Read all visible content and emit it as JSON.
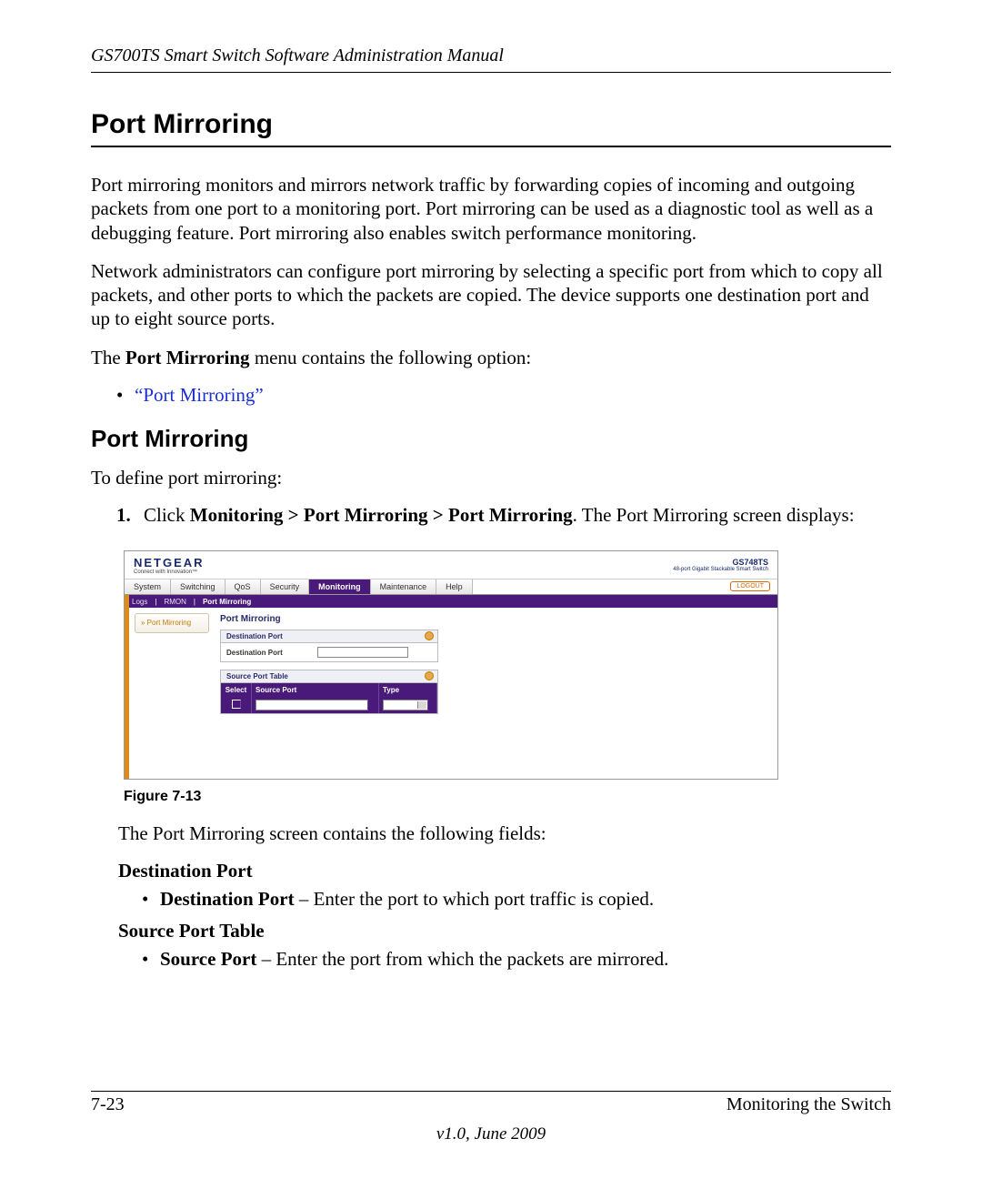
{
  "header": {
    "manual_title": "GS700TS Smart Switch Software Administration Manual"
  },
  "section": {
    "title": "Port Mirroring"
  },
  "paragraphs": {
    "p1": "Port mirroring monitors and mirrors network traffic by forwarding copies of incoming and outgoing packets from one port to a monitoring port. Port mirroring can be used as a diagnostic tool as well as a debugging feature. Port mirroring also enables switch performance monitoring.",
    "p2": "Network administrators can configure port mirroring by selecting a specific port from which to copy all packets, and other ports to which the packets are copied. The device supports one destination port and up to eight source ports.",
    "p3_prefix": "The ",
    "p3_bold": "Port Mirroring",
    "p3_suffix": " menu contains the following option:",
    "link1": "“Port Mirroring”"
  },
  "subsection": {
    "title": "Port Mirroring",
    "intro": "To define port mirroring:",
    "step1_prefix": "Click ",
    "step1_bold": "Monitoring > Port Mirroring > Port Mirroring",
    "step1_suffix": ". The Port Mirroring screen displays:"
  },
  "figure": {
    "caption": "Figure 7-13",
    "logo": "NETGEAR",
    "logo_sub": "Connect with Innovation™",
    "model": "GS748TS",
    "model_sub": "48-port Gigabit Stackable Smart Switch",
    "tabs": [
      "System",
      "Switching",
      "QoS",
      "Security",
      "Monitoring",
      "Maintenance",
      "Help"
    ],
    "active_tab_index": 4,
    "logout": "LOGOUT",
    "subtabs": [
      "Logs",
      "RMON",
      "Port Mirroring"
    ],
    "active_subtab_index": 2,
    "side_item": "» Port Mirroring",
    "panel_title": "Port Mirroring",
    "box1_header": "Destination Port",
    "box1_label": "Destination Port",
    "box2_header": "Source Port Table",
    "thead": {
      "select": "Select",
      "source": "Source Port",
      "type": "Type"
    }
  },
  "after_figure": {
    "p": "The Port Mirroring screen contains the following fields:",
    "dest_hdr": "Destination Port",
    "dest_bullet_bold": "Destination Port",
    "dest_bullet_rest": " – Enter the port to which port traffic is copied.",
    "src_hdr": "Source Port Table",
    "src_bullet_bold": "Source Port",
    "src_bullet_rest": " – Enter the port from which the packets are mirrored."
  },
  "footer": {
    "page": "7-23",
    "chapter": "Monitoring the Switch",
    "version": "v1.0, June 2009"
  }
}
